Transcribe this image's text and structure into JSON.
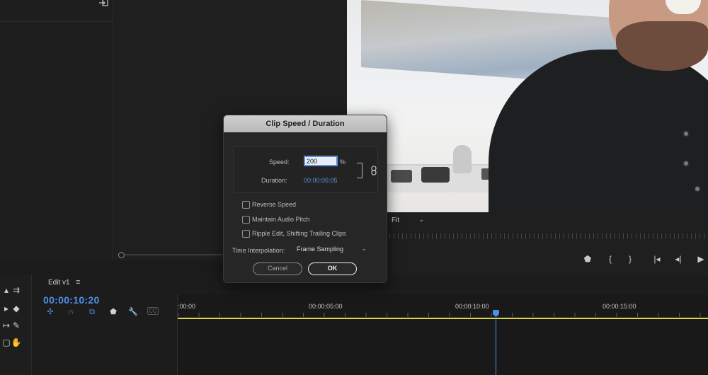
{
  "dialog": {
    "title": "Clip Speed / Duration",
    "speed_label": "Speed:",
    "speed_value": "200",
    "speed_unit": "%",
    "duration_label": "Duration:",
    "duration_value": "00:00:05:05",
    "checkboxes": [
      {
        "label": "Reverse Speed",
        "checked": false
      },
      {
        "label": "Maintain Audio Pitch",
        "checked": false
      },
      {
        "label": "Ripple Edit, Shifting Trailing Clips",
        "checked": false
      }
    ],
    "time_interp_label": "Time Interpolation:",
    "time_interp_value": "Frame Sampling",
    "cancel_label": "Cancel",
    "ok_label": "OK"
  },
  "monitor": {
    "zoom_value": "Fit"
  },
  "timeline": {
    "sequence_name": "Edit v1",
    "menu_glyph": "≡",
    "timecode": "00:00:10:20",
    "ruler_labels": [
      ":00:00",
      "00:00:05:00",
      "00:00:10:00",
      "00:00:15:00"
    ],
    "cc_label": "CC"
  },
  "colors": {
    "accent_blue": "#4f8fe6",
    "timeline_yellow": "#d9d94a",
    "dialog_bg": "#262626"
  }
}
